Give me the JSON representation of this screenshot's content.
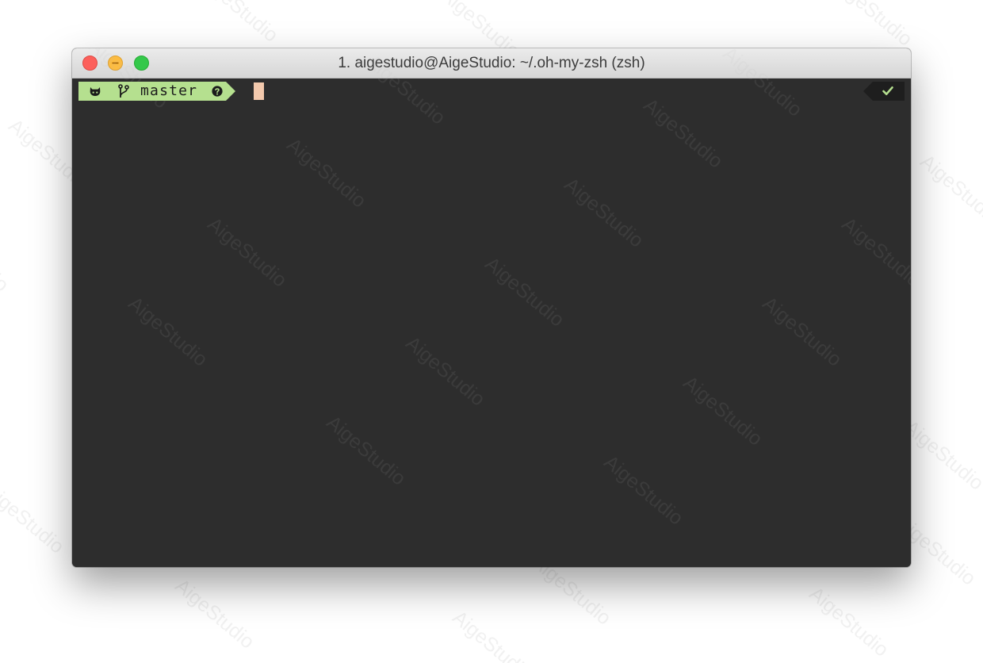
{
  "window": {
    "title": "1. aigestudio@AigeStudio: ~/.oh-my-zsh (zsh)"
  },
  "prompt": {
    "branch_name": "master",
    "segment_color": "#b5e08f",
    "cursor_color": "#f3c9ad",
    "left_icons": [
      "octocat-icon",
      "git-branch-icon",
      "question-circle-icon"
    ],
    "status_icon": "check-icon",
    "status_color": "#b5e08f"
  },
  "colors": {
    "terminal_background": "#2d2d2d",
    "close": "#fc605b",
    "minimize": "#fdbc40",
    "maximize": "#34c84a"
  },
  "watermark": {
    "text": "AigeStudio"
  }
}
